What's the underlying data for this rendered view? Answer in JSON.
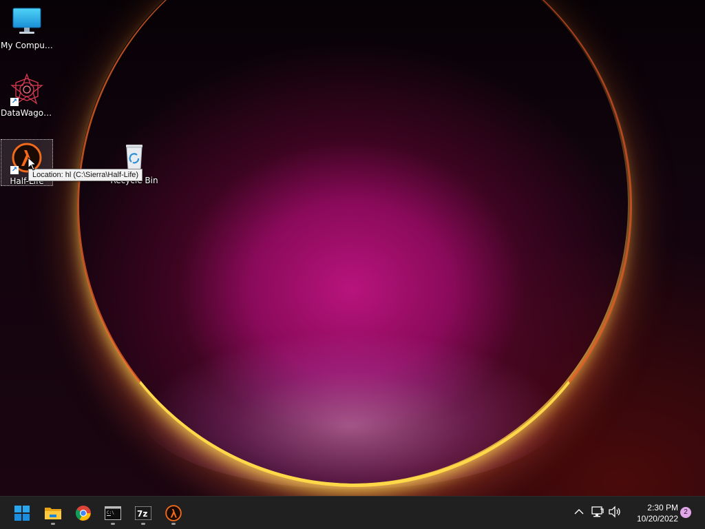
{
  "desktop": {
    "icons": [
      {
        "name": "my-computer",
        "label": "My Computer",
        "icon": "monitor-icon",
        "shortcut": false
      },
      {
        "name": "datawagon",
        "label": "DataWagon...",
        "icon": "datawagon-icon",
        "shortcut": true
      },
      {
        "name": "half-life",
        "label": "Half-Life",
        "icon": "half-life-lambda-icon",
        "shortcut": true,
        "selected": true
      },
      {
        "name": "recycle-bin",
        "label": "Recycle Bin",
        "icon": "recycle-bin-icon",
        "shortcut": false
      }
    ],
    "tooltip": "Location: hl (C:\\Sierra\\Half-Life)"
  },
  "taskbar": {
    "pinned": [
      {
        "name": "start",
        "icon": "windows-start-icon",
        "running": false
      },
      {
        "name": "file-explorer",
        "icon": "folder-icon",
        "running": true
      },
      {
        "name": "chrome",
        "icon": "chrome-icon",
        "running": false
      },
      {
        "name": "command-prompt",
        "icon": "terminal-icon",
        "running": true
      },
      {
        "name": "7zip",
        "icon": "7zip-icon",
        "running": true
      },
      {
        "name": "half-life",
        "icon": "half-life-lambda-icon",
        "running": true
      }
    ],
    "tray": {
      "show_hidden_icon": "chevron-up-icon",
      "network_icon": "network-icon",
      "volume_icon": "volume-icon"
    },
    "clock": {
      "time": "2:30 PM",
      "date": "10/20/2022"
    },
    "notifications": {
      "count": "2"
    }
  },
  "colors": {
    "accent_start": "#0078d4",
    "halflife_orange": "#f26a1b",
    "taskbar_bg": "#202020"
  }
}
